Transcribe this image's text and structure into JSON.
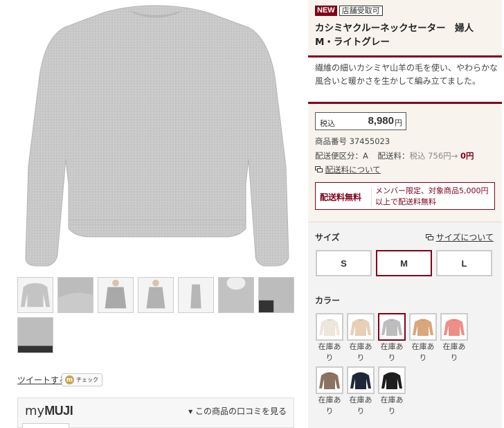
{
  "product": {
    "tags": {
      "new": "NEW",
      "store_pickup": "店舗受取可"
    },
    "title": "カシミヤクルーネックセーター　婦人　M・ライトグレー",
    "description": "繊維の細いカシミヤ山羊の毛を使い、やわらかな風合いと暖かさを生かして編み立てました。",
    "price": {
      "tax_label": "税込",
      "amount": "8,980",
      "yen": "円"
    },
    "item_number": "商品番号 37455023",
    "shipping_class": "配送便区分：A",
    "shipping_fee_label": "配送料：",
    "shipping_fee_old": "税込 756円→",
    "shipping_fee_new": "0円",
    "shipping_link": "配送料について",
    "free_shipping_label": "配送料無料",
    "free_shipping_desc": "メンバー限定、対象商品5,000円以上で配送料無料",
    "main_color": "#cfcfcf"
  },
  "size": {
    "heading": "サイズ",
    "guide_link": "サイズについて",
    "options": [
      "S",
      "M",
      "L"
    ],
    "selected": "M"
  },
  "color": {
    "heading": "カラー",
    "swatches": [
      {
        "color": "#efe6db",
        "stock": "在庫あり"
      },
      {
        "color": "#e8cfb6",
        "stock": "在庫あり"
      },
      {
        "color": "#bdbdbd",
        "stock": "在庫あり",
        "selected": true
      },
      {
        "color": "#d9a77a",
        "stock": "在庫あり"
      },
      {
        "color": "#ef8e84",
        "stock": "在庫あり"
      },
      {
        "color": "#8b7262",
        "stock": "在庫あり"
      },
      {
        "color": "#1f2838",
        "stock": "在庫あり"
      },
      {
        "color": "#1e1e1e",
        "stock": "在庫あり"
      }
    ]
  },
  "social": {
    "tweet": "ツイートする",
    "check": "チェック",
    "check_logo": "m"
  },
  "mymuji": {
    "my": "my",
    "muji": "MUJI",
    "review_link": "▾ この商品の口コミを見る"
  }
}
